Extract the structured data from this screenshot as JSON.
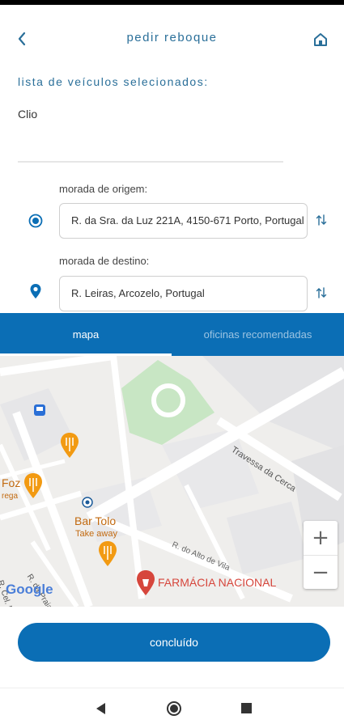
{
  "header": {
    "title": "pedir reboque",
    "back_icon": "chevron-left-icon",
    "home_icon": "home-icon"
  },
  "vehicles": {
    "section_label": "lista de veículos selecionados:",
    "items": [
      "Clio"
    ]
  },
  "origin": {
    "label": "morada de origem:",
    "value": "R. da Sra. da Luz 221A, 4150-671 Porto, Portugal"
  },
  "destination": {
    "label": "morada de destino:",
    "value": "R. Leiras, Arcozelo, Portugal"
  },
  "tabs": [
    {
      "label": "mapa",
      "active": true
    },
    {
      "label": "oficinas recomendadas",
      "active": false
    }
  ],
  "map": {
    "street_labels": [
      "Travessa da Cerca",
      "R. do Alto de Vila",
      "R. da Praia",
      "R. Cel. Raul Pe"
    ],
    "places": [
      "Bar Tolo",
      "Take away",
      "FARMÁCIA NACIONAL",
      "Foz",
      "rega"
    ],
    "logo": "Google",
    "zoom_in": "+",
    "zoom_out": "−"
  },
  "actions": {
    "confirm": "concluído"
  },
  "colors": {
    "primary": "#0b6eb5",
    "title_text": "#2a6f99",
    "inactive_tab": "#9cc4e2",
    "map_park": "#c8e6c4",
    "map_poi_orange": "#f29a12",
    "map_poi_red": "#d6463c"
  }
}
